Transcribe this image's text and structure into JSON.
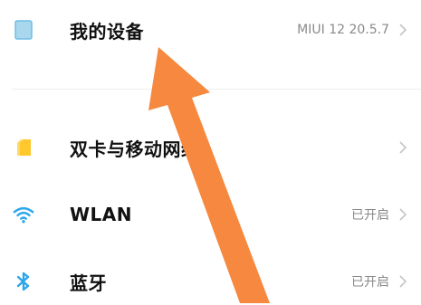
{
  "settings": {
    "items": [
      {
        "label": "我的设备",
        "value": "MIUI 12 20.5.7",
        "icon": "device-icon"
      },
      {
        "label": "双卡与移动网络",
        "value": "",
        "icon": "sim-card-icon"
      },
      {
        "label": "WLAN",
        "value": "已开启",
        "icon": "wifi-icon"
      },
      {
        "label": "蓝牙",
        "value": "已开启",
        "icon": "bluetooth-icon"
      }
    ]
  },
  "colors": {
    "device_icon": "#a9d8ee",
    "sim_icon": "#ffc82c",
    "wifi_icon": "#2aa6ea",
    "bluetooth_icon": "#2aa6ea",
    "arrow": "#f6883f",
    "value_text": "#8a8a8a",
    "chevron": "#c5c5c5"
  }
}
